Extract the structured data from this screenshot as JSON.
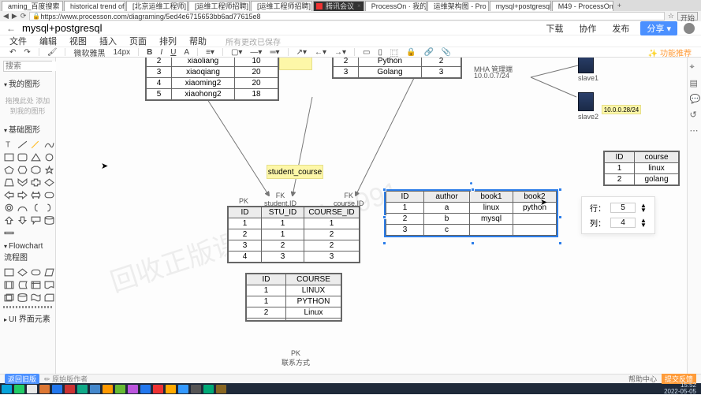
{
  "browser": {
    "tabs": [
      "aming_百度搜索",
      "historical trend of",
      "[北京运维工程师]",
      "[运维工程师招聘]",
      "[运维工程师招聘]",
      "腾讯会议",
      "ProcessOn · 我的",
      "运维架构图 - Pro",
      "mysql+postgresql",
      "M49 - ProcessOn"
    ],
    "activeTabIndex": 8,
    "url": "https://www.processon.com/diagraming/5ed4e6715653bb6ad77615e8",
    "startBtn": "开始"
  },
  "header": {
    "docTitle": "mysql+postgresql",
    "buttons": {
      "download": "下载",
      "collab": "协作",
      "publish": "发布",
      "share": "分享 ▾"
    }
  },
  "menus": [
    "文件",
    "编辑",
    "视图",
    "插入",
    "页面",
    "排列",
    "帮助"
  ],
  "menuHint": "所有更改已保存",
  "toolbar": {
    "font": "微软雅黑",
    "fontSize": "14px",
    "featureBtn": "✨ 功能推荐"
  },
  "sidebar": {
    "searchPlaceholder": "搜索",
    "sections": {
      "myShapes": "我的图形",
      "dragHint": "拖拽此处\n添加到我的图形",
      "basicShapes": "基础图形",
      "flowchart": "Flowchart 流程图",
      "uiElem": "UI 界面元素"
    }
  },
  "canvas": {
    "sticky1": "student_course",
    "watermark1": "回收正版课+v: kunlun991",
    "mha": "MHA 管理端",
    "ip1": "10.0.0.7/24",
    "ip2": "10.0.0.28/24",
    "slave1": "slave1",
    "slave2": "slave2",
    "pkLabel": "PK",
    "fkLabel": "FK",
    "fkStudent": "student.ID",
    "fkCourse": "course.ID",
    "fkBottom": "联系方式",
    "tableTop1": {
      "rows": [
        [
          "2",
          "xiaoliang",
          "10"
        ],
        [
          "3",
          "xiaoqiang",
          "20"
        ],
        [
          "4",
          "xiaoming2",
          "20"
        ],
        [
          "5",
          "xiaohong2",
          "18"
        ]
      ]
    },
    "tableTop2": {
      "rows": [
        [
          "2",
          "Python",
          "2"
        ],
        [
          "3",
          "Golang",
          "3"
        ]
      ]
    },
    "tableStuCourse": {
      "headers": [
        "ID",
        "STU_ID",
        "COURSE_ID"
      ],
      "rows": [
        [
          "1",
          "1",
          "1"
        ],
        [
          "2",
          "1",
          "2"
        ],
        [
          "3",
          "2",
          "2"
        ],
        [
          "4",
          "3",
          "3"
        ]
      ]
    },
    "tableAuthor": {
      "headers": [
        "ID",
        "author",
        "book1",
        "book2"
      ],
      "rows": [
        [
          "1",
          "a",
          "linux",
          "python"
        ],
        [
          "2",
          "b",
          "mysql",
          ""
        ],
        [
          "3",
          "c",
          "",
          ""
        ]
      ]
    },
    "tableIdCourse": {
      "headers": [
        "ID",
        "COURSE"
      ],
      "rows": [
        [
          "1",
          "LINUX"
        ],
        [
          "1",
          "PYTHON"
        ],
        [
          "2",
          "Linux"
        ],
        [
          "",
          ""
        ]
      ]
    },
    "tableCourse": {
      "headers": [
        "ID",
        "course"
      ],
      "rows": [
        [
          "1",
          "linux"
        ],
        [
          "2",
          "golang"
        ]
      ]
    },
    "dimPanel": {
      "rowLabel": "行：",
      "colLabel": "列：",
      "rows": "5",
      "cols": "4"
    }
  },
  "footer": {
    "leftIcon": "返回旧版",
    "leftSub": "原始版作者",
    "help": "帮助中心",
    "feedback": "提交反馈"
  },
  "taskbar": {
    "time": "15:52",
    "date": "2022-05-05"
  }
}
